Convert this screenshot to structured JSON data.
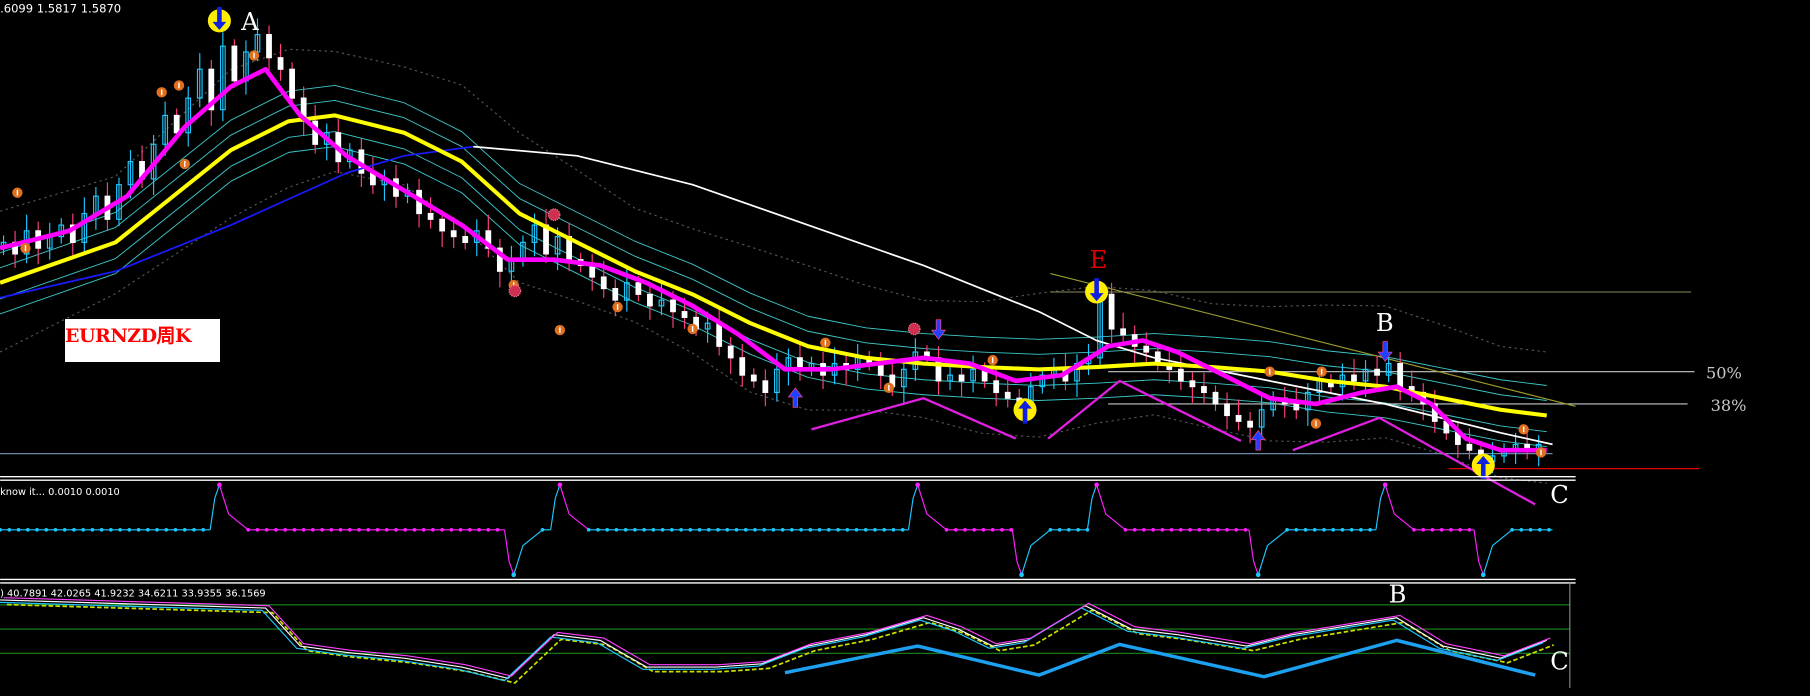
{
  "header": {
    "price_readout": ".6099 1.5817 1.5870"
  },
  "label": {
    "symbol": "EURNZD周K"
  },
  "indicator1": {
    "header": "know it...  0.0010 0.0010",
    "peaks": [
      19,
      48.5,
      79.5,
      95,
      120
    ],
    "troughs": [
      44.5,
      88.5,
      109,
      128.5
    ]
  },
  "indicator2": {
    "header": ") 40.7891 42.0265 41.9232 34.6211 33.9355 36.1569",
    "levels": [
      80,
      50,
      20
    ],
    "osc": [
      [
        0,
        86
      ],
      [
        23,
        76
      ],
      [
        26,
        29
      ],
      [
        30,
        21
      ],
      [
        35,
        14
      ],
      [
        40,
        3
      ],
      [
        44,
        -11
      ],
      [
        48,
        43
      ],
      [
        52,
        36
      ],
      [
        56,
        3
      ],
      [
        62,
        3
      ],
      [
        66,
        7
      ],
      [
        70,
        29
      ],
      [
        75,
        43
      ],
      [
        80,
        64
      ],
      [
        83,
        50
      ],
      [
        86,
        29
      ],
      [
        89,
        36
      ],
      [
        94,
        79
      ],
      [
        98,
        50
      ],
      [
        102,
        43
      ],
      [
        108,
        29
      ],
      [
        112,
        43
      ],
      [
        118,
        57
      ],
      [
        121,
        64
      ],
      [
        125,
        29
      ],
      [
        130,
        14
      ],
      [
        134,
        36
      ]
    ],
    "zigzag": [
      [
        68,
        -4
      ],
      [
        79.5,
        29
      ],
      [
        90,
        -7
      ],
      [
        97,
        31
      ],
      [
        109.5,
        -9
      ],
      [
        121,
        36
      ],
      [
        133,
        -7
      ]
    ]
  },
  "annotations": {
    "A": "A",
    "E": "E",
    "B": "B",
    "C": "C",
    "B2": "B",
    "C2": "C",
    "fib50": "50%",
    "fib38": "38%"
  },
  "colors": {
    "bg": "#000000",
    "ma_fast": "#ff00ff",
    "ma_mid": "#ffff00",
    "ma_slow": "#ffffff",
    "ma_long": "#1a1aff",
    "band": "#3cc8c8",
    "up": "#1ec8ff",
    "down": "#ffffff",
    "zigzag_price": "#e020e0",
    "zigzag_osc": "#1ea0f0",
    "fib": "#c8c8c8",
    "trend": "#9a9a30",
    "support": "#e00000"
  },
  "chart_data": {
    "type": "candlestick",
    "symbol": "EURNZD",
    "timeframe": "weekly",
    "ylim": [
      1.676,
      2.5
    ],
    "closes": [
      2.08,
      2.06,
      2.1,
      2.07,
      2.09,
      2.11,
      2.08,
      2.13,
      2.16,
      2.12,
      2.18,
      2.22,
      2.19,
      2.25,
      2.3,
      2.27,
      2.33,
      2.38,
      2.31,
      2.42,
      2.36,
      2.41,
      2.44,
      2.4,
      2.38,
      2.33,
      2.29,
      2.25,
      2.27,
      2.22,
      2.24,
      2.2,
      2.18,
      2.19,
      2.16,
      2.17,
      2.13,
      2.12,
      2.1,
      2.09,
      2.08,
      2.1,
      2.07,
      2.03,
      2.05,
      2.08,
      2.11,
      2.06,
      2.09,
      2.05,
      2.04,
      2.02,
      2.0,
      1.98,
      2.01,
      1.99,
      1.97,
      1.98,
      1.96,
      1.95,
      1.93,
      1.94,
      1.9,
      1.88,
      1.85,
      1.84,
      1.82,
      1.86,
      1.88,
      1.86,
      1.87,
      1.85,
      1.87,
      1.86,
      1.88,
      1.87,
      1.85,
      1.83,
      1.86,
      1.89,
      1.88,
      1.84,
      1.85,
      1.84,
      1.86,
      1.84,
      1.82,
      1.81,
      1.8,
      1.83,
      1.85,
      1.86,
      1.84,
      1.87,
      1.88,
      1.99,
      1.93,
      1.92,
      1.9,
      1.89,
      1.87,
      1.86,
      1.84,
      1.83,
      1.82,
      1.8,
      1.78,
      1.77,
      1.76,
      1.79,
      1.81,
      1.8,
      1.79,
      1.82,
      1.84,
      1.83,
      1.85,
      1.84,
      1.86,
      1.85,
      1.87,
      1.83,
      1.82,
      1.8,
      1.77,
      1.75,
      1.73,
      1.72,
      1.7,
      1.71,
      1.72,
      1.73,
      1.72,
      1.73
    ],
    "ma_fast": [
      [
        0,
        2.07
      ],
      [
        6,
        2.1
      ],
      [
        11,
        2.16
      ],
      [
        16,
        2.28
      ],
      [
        20,
        2.35
      ],
      [
        23,
        2.38
      ],
      [
        26,
        2.3
      ],
      [
        30,
        2.23
      ],
      [
        35,
        2.17
      ],
      [
        40,
        2.11
      ],
      [
        44,
        2.05
      ],
      [
        48,
        2.05
      ],
      [
        52,
        2.04
      ],
      [
        56,
        2.01
      ],
      [
        60,
        1.97
      ],
      [
        64,
        1.92
      ],
      [
        68,
        1.86
      ],
      [
        72,
        1.86
      ],
      [
        76,
        1.87
      ],
      [
        80,
        1.88
      ],
      [
        84,
        1.87
      ],
      [
        88,
        1.84
      ],
      [
        92,
        1.85
      ],
      [
        96,
        1.9
      ],
      [
        99,
        1.91
      ],
      [
        102,
        1.89
      ],
      [
        106,
        1.85
      ],
      [
        110,
        1.81
      ],
      [
        114,
        1.8
      ],
      [
        118,
        1.82
      ],
      [
        121,
        1.83
      ],
      [
        124,
        1.8
      ],
      [
        127,
        1.74
      ],
      [
        130,
        1.72
      ],
      [
        134,
        1.72
      ]
    ],
    "ma_mid": [
      [
        0,
        2.01
      ],
      [
        10,
        2.08
      ],
      [
        20,
        2.24
      ],
      [
        25,
        2.29
      ],
      [
        29,
        2.3
      ],
      [
        35,
        2.27
      ],
      [
        40,
        2.22
      ],
      [
        45,
        2.13
      ],
      [
        50,
        2.08
      ],
      [
        55,
        2.03
      ],
      [
        60,
        1.99
      ],
      [
        65,
        1.94
      ],
      [
        70,
        1.9
      ],
      [
        75,
        1.88
      ],
      [
        80,
        1.87
      ],
      [
        85,
        1.864
      ],
      [
        90,
        1.86
      ],
      [
        95,
        1.864
      ],
      [
        100,
        1.87
      ],
      [
        105,
        1.864
      ],
      [
        110,
        1.856
      ],
      [
        115,
        1.84
      ],
      [
        120,
        1.83
      ],
      [
        125,
        1.81
      ],
      [
        130,
        1.79
      ],
      [
        134,
        1.78
      ]
    ],
    "ma_long": [
      [
        0,
        1.984
      ],
      [
        10,
        2.03
      ],
      [
        20,
        2.11
      ],
      [
        30,
        2.2
      ],
      [
        35,
        2.23
      ],
      [
        41,
        2.246
      ]
    ],
    "ma_slow": [
      [
        41,
        2.246
      ],
      [
        50,
        2.23
      ],
      [
        60,
        2.18
      ],
      [
        70,
        2.11
      ],
      [
        80,
        2.04
      ],
      [
        90,
        1.96
      ],
      [
        95,
        1.91
      ],
      [
        100,
        1.88
      ],
      [
        110,
        1.84
      ],
      [
        120,
        1.8
      ],
      [
        130,
        1.75
      ],
      [
        134.5,
        1.73
      ]
    ],
    "fib_levels": [
      {
        "label": "50%",
        "price": 1.856
      },
      {
        "label": "38%",
        "price": 1.8
      }
    ],
    "support": 1.688,
    "baseline": 1.714,
    "trendline": [
      [
        91,
        2.026
      ],
      [
        136.5,
        1.796
      ]
    ],
    "zigzag": [
      [
        70.3,
        1.756
      ],
      [
        80,
        1.81
      ],
      [
        88,
        1.74
      ],
      [
        90.8,
        1.74
      ],
      [
        97,
        1.84
      ],
      [
        107.5,
        1.736
      ],
      [
        112,
        1.72
      ],
      [
        119.5,
        1.776
      ],
      [
        129,
        1.67
      ],
      [
        133,
        1.626
      ]
    ],
    "signals": {
      "sell_circle": [
        [
          19,
          2.464
        ],
        [
          95,
          1.994
        ]
      ],
      "buy_circle": [
        [
          88.8,
          1.79
        ],
        [
          128.5,
          1.694
        ]
      ],
      "buy_arrow": [
        [
          68.9,
          1.814
        ],
        [
          109,
          1.74
        ]
      ],
      "sell_arrow": [
        [
          81.3,
          1.926
        ],
        [
          120,
          1.888
        ]
      ],
      "marker_1": [
        [
          1.5,
          2.166
        ],
        [
          2.2,
          2.07
        ],
        [
          14,
          2.34
        ],
        [
          15.5,
          2.352
        ],
        [
          16,
          2.216
        ],
        [
          22,
          2.404
        ],
        [
          44.5,
          2.006
        ],
        [
          48.5,
          1.928
        ],
        [
          53.5,
          1.968
        ],
        [
          60,
          1.93
        ],
        [
          71.5,
          1.906
        ],
        [
          77,
          1.828
        ],
        [
          86,
          1.876
        ],
        [
          110,
          1.856
        ],
        [
          114.5,
          1.856
        ],
        [
          114,
          1.766
        ],
        [
          132,
          1.756
        ],
        [
          133.5,
          1.716
        ]
      ],
      "star": [
        [
          48,
          2.128
        ],
        [
          44.6,
          1.996
        ],
        [
          79.2,
          1.93
        ]
      ]
    }
  }
}
